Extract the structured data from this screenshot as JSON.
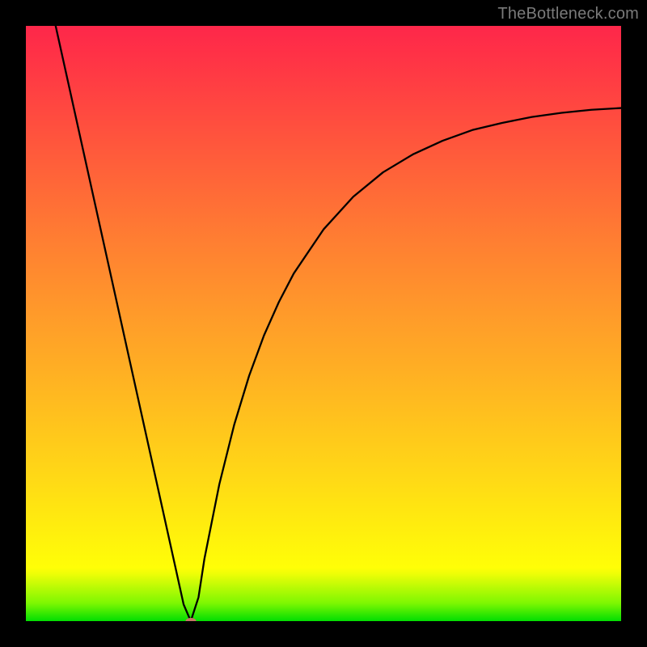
{
  "watermark": "TheBottleneck.com",
  "colors": {
    "frame": "#000000",
    "curve": "#000000",
    "marker": "#c57565"
  },
  "chart_data": {
    "type": "line",
    "title": "",
    "xlabel": "",
    "ylabel": "",
    "xlim": [
      0,
      100
    ],
    "ylim": [
      0,
      100
    ],
    "grid": false,
    "legend": false,
    "background_gradient": {
      "direction": "vertical",
      "stops": [
        {
          "pos": 0,
          "color": "#01de02"
        },
        {
          "pos": 3,
          "color": "#7df702"
        },
        {
          "pos": 8,
          "color": "#effe07"
        },
        {
          "pos": 9,
          "color": "#fffe07"
        },
        {
          "pos": 24,
          "color": "#ffd916"
        },
        {
          "pos": 43,
          "color": "#ffad24"
        },
        {
          "pos": 50,
          "color": "#ff9e29"
        },
        {
          "pos": 64,
          "color": "#ff7e32"
        },
        {
          "pos": 80,
          "color": "#ff573c"
        },
        {
          "pos": 95,
          "color": "#ff3246"
        },
        {
          "pos": 100,
          "color": "#fe274a"
        }
      ]
    },
    "series": [
      {
        "name": "curve",
        "x": [
          5.0,
          7.5,
          10.0,
          12.5,
          15.0,
          17.5,
          20.0,
          22.5,
          25.0,
          26.5,
          27.7,
          29.0,
          30.0,
          32.5,
          35.0,
          37.5,
          40.0,
          42.5,
          45.0,
          50.0,
          55.0,
          60.0,
          65.0,
          70.0,
          75.0,
          80.0,
          85.0,
          90.0,
          95.0,
          100.0
        ],
        "y": [
          100.0,
          88.7,
          77.4,
          66.1,
          54.8,
          43.5,
          32.2,
          20.9,
          9.6,
          2.8,
          0.0,
          4.0,
          10.5,
          23.0,
          33.0,
          41.2,
          48.0,
          53.6,
          58.4,
          65.8,
          71.3,
          75.4,
          78.4,
          80.7,
          82.5,
          83.7,
          84.7,
          85.4,
          85.9,
          86.2
        ]
      }
    ],
    "marker": {
      "x": 27.7,
      "y": 0.0,
      "color": "#c57565"
    }
  }
}
